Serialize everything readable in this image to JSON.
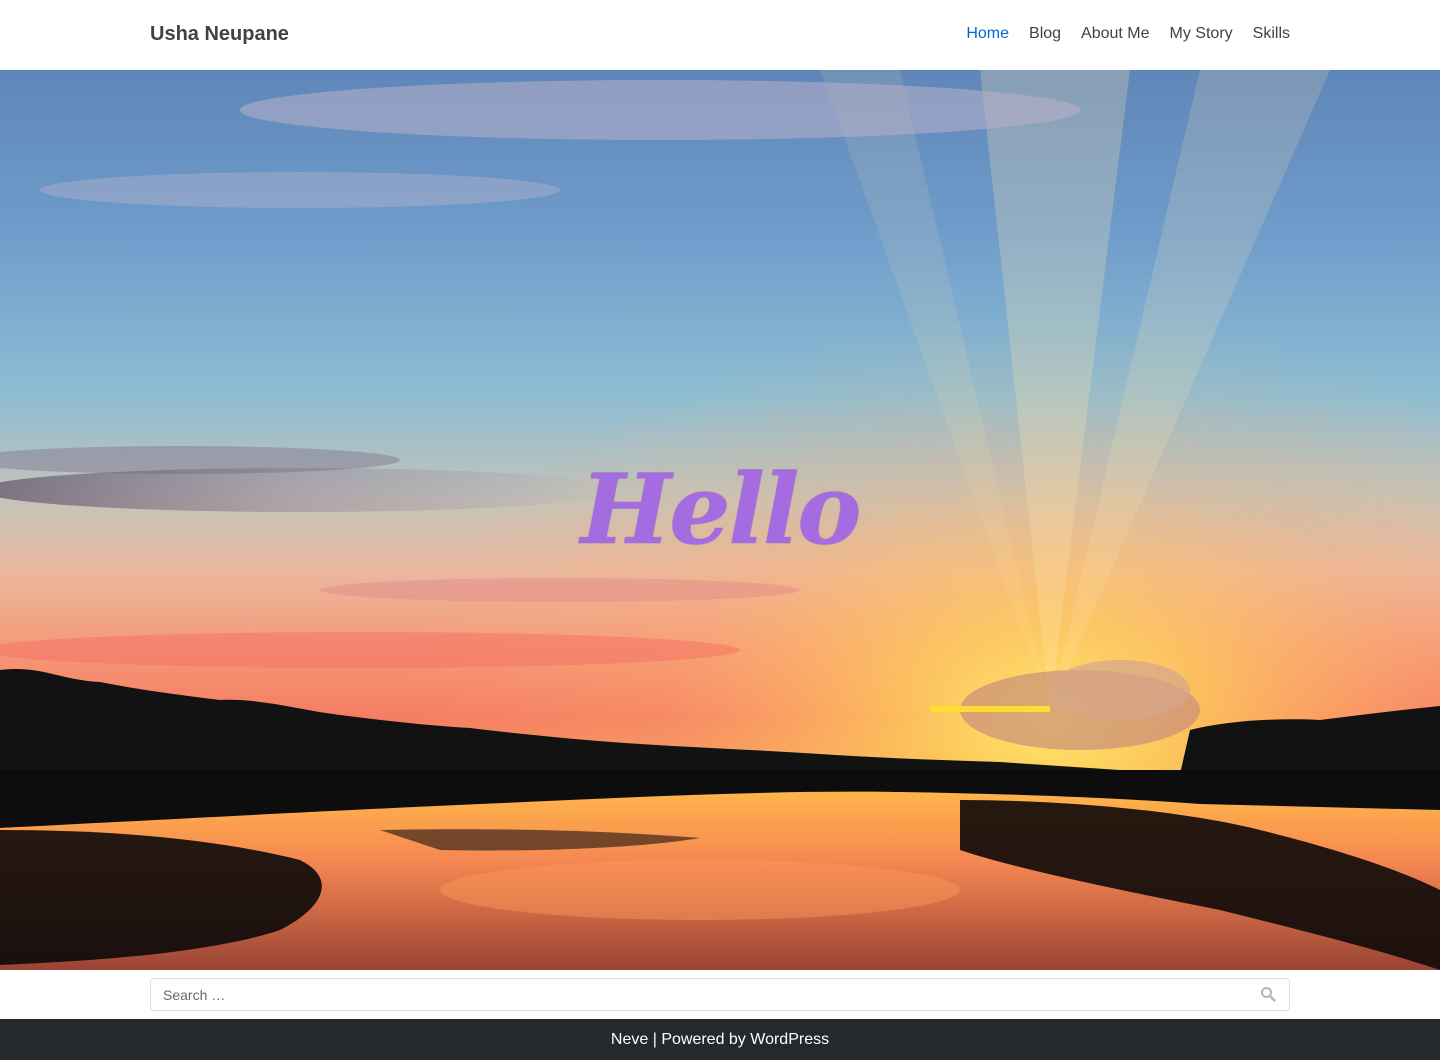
{
  "header": {
    "site_title": "Usha Neupane",
    "nav": [
      {
        "label": "Home",
        "active": true
      },
      {
        "label": "Blog",
        "active": false
      },
      {
        "label": "About Me",
        "active": false
      },
      {
        "label": "My Story",
        "active": false
      },
      {
        "label": "Skills",
        "active": false
      }
    ],
    "active_color": "#0366d6"
  },
  "hero": {
    "title": "Hello",
    "title_color": "#a56be0"
  },
  "search": {
    "placeholder": "Search …",
    "icon": "search-icon"
  },
  "footer": {
    "theme_link": "Neve",
    "separator": " | Powered by ",
    "platform_link": "WordPress",
    "background": "#24292e"
  }
}
